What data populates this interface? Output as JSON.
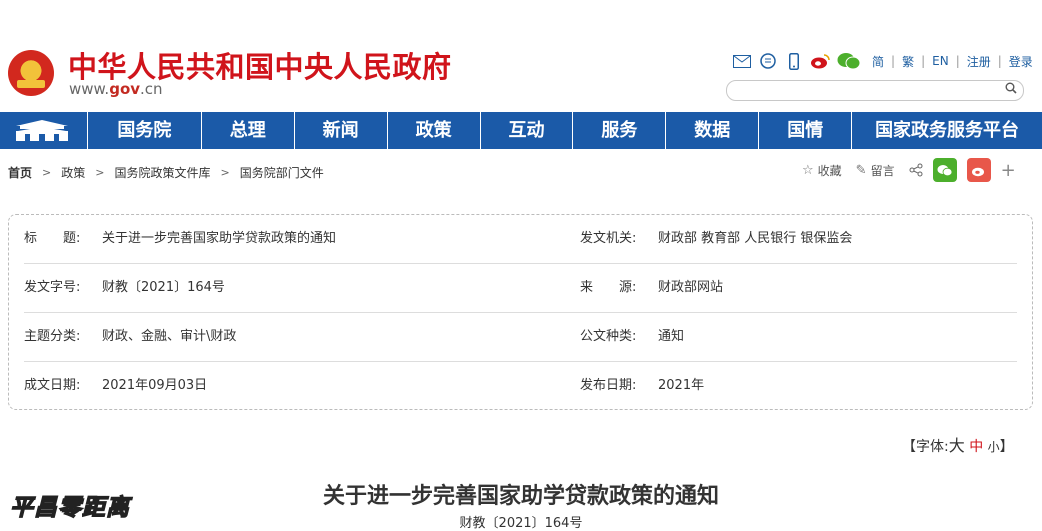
{
  "header": {
    "title": "中华人民共和国中央人民政府",
    "url_prefix": "www.",
    "url_gov": "gov",
    "url_suffix": ".cn",
    "tools": {
      "mail_icon": "envelope-icon",
      "chat_icon": "chat-bubble-icon",
      "mobile_icon": "mobile-phone-icon",
      "weibo_icon": "weibo-icon",
      "wechat_icon": "wechat-icon"
    },
    "lang_simplified": "简",
    "lang_traditional": "繁",
    "lang_en": "EN",
    "register": "注册",
    "login": "登录",
    "search_placeholder": ""
  },
  "nav": {
    "items": [
      "国务院",
      "总理",
      "新闻",
      "政策",
      "互动",
      "服务",
      "数据",
      "国情",
      "国家政务服务平台"
    ]
  },
  "breadcrumb": [
    "首页",
    "政策",
    "国务院政策文件库",
    "国务院部门文件"
  ],
  "actions": {
    "favorite": "收藏",
    "comment": "留言"
  },
  "meta": {
    "title_label": "标　　题:",
    "title_value": "关于进一步完善国家助学贷款政策的通知",
    "issuer_label": "发文机关:",
    "issuer_value": "财政部 教育部 人民银行 银保监会",
    "docno_label": "发文字号:",
    "docno_value": "财教〔2021〕164号",
    "source_label": "来　　源:",
    "source_value": "财政部网站",
    "topic_label": "主题分类:",
    "topic_value": "财政、金融、审计\\财政",
    "type_label": "公文种类:",
    "type_value": "通知",
    "date_label": "成文日期:",
    "date_value": "2021年09月03日",
    "pub_label": "发布日期:",
    "pub_value": "2021年"
  },
  "fontsize": {
    "prefix": "【字体:",
    "large": "大",
    "medium": "中",
    "small": "小",
    "suffix": "】"
  },
  "article": {
    "title": "关于进一步完善国家助学贷款政策的通知",
    "doc_number": "财教〔2021〕164号"
  },
  "watermark": "平昌零距离",
  "colors": {
    "brand_red": "#d0141b",
    "nav_blue": "#1b5aa8"
  }
}
